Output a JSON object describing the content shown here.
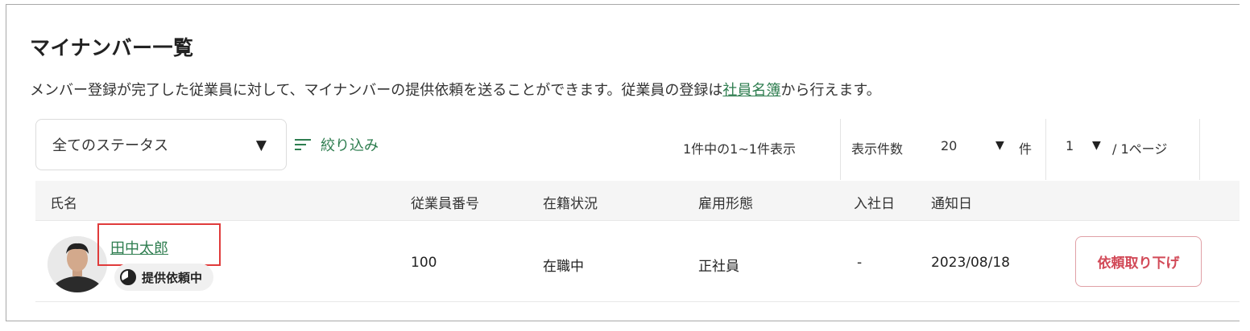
{
  "page": {
    "title": "マイナンバー一覧",
    "description_before": "メンバー登録が完了した従業員に対して、マイナンバーの提供依頼を送ることができます。従業員の登録は",
    "description_link": "社員名簿",
    "description_after": "から行えます。"
  },
  "filters": {
    "status_value": "全てのステータス",
    "filter_label": "絞り込み"
  },
  "pagination": {
    "info": "1件中の1~1件表示",
    "per_page_label": "表示件数",
    "per_page_value": "20",
    "per_page_unit": "件",
    "current_page": "1",
    "total_pages": "/ 1ページ"
  },
  "table": {
    "columns": {
      "name": "氏名",
      "employee_no": "従業員番号",
      "status": "在籍状況",
      "employment_type": "雇用形態",
      "join_date": "入社日",
      "notice_date": "通知日"
    },
    "rows": [
      {
        "name": "田中太郎",
        "badge": "提供依頼中",
        "employee_no": "100",
        "status": "在職中",
        "employment_type": "正社員",
        "join_date": "-",
        "notice_date": "2023/08/18",
        "action": "依頼取り下げ"
      }
    ]
  },
  "colors": {
    "accent_green": "#2e7d4f",
    "danger_red": "#d24a58",
    "highlight_red": "#e03b3b"
  }
}
